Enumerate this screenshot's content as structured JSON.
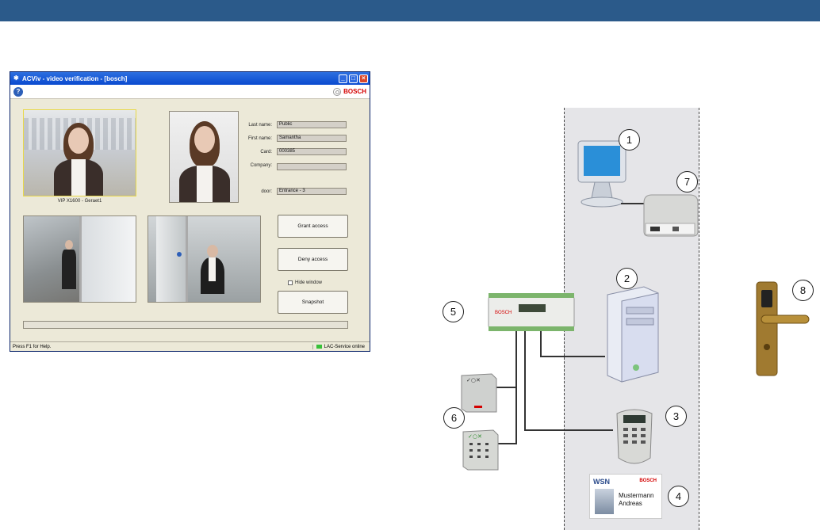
{
  "window": {
    "title": "ACViv - video verification - [bosch]",
    "brand": "BOSCH",
    "camera_caption": "VIP X1600 - Geraet1",
    "fields": [
      {
        "label": "Last name:",
        "value": "Public"
      },
      {
        "label": "First name:",
        "value": "Samantha"
      },
      {
        "label": "Card:",
        "value": "000385"
      },
      {
        "label": "Company:",
        "value": ""
      },
      {
        "label": "door:",
        "value": "Entrance - 3"
      }
    ],
    "buttons": {
      "grant": "Grant access",
      "deny": "Deny access",
      "snapshot": "Snapshot"
    },
    "hide_window": "Hide window",
    "status_left": "Press F1 for Help.",
    "status_right": "LAC-Service online"
  },
  "diagram": {
    "numbers": [
      "1",
      "2",
      "3",
      "4",
      "5",
      "6",
      "7",
      "8"
    ],
    "card": {
      "label": "WSN",
      "brand": "BOSCH",
      "surname": "Mustermann",
      "firstname": "Andreas"
    }
  },
  "colors": {
    "topbar": "#2b5a8a",
    "titlebar": "#0a4ad0",
    "brand": "#d40000",
    "zone": "#e5e5e8"
  }
}
